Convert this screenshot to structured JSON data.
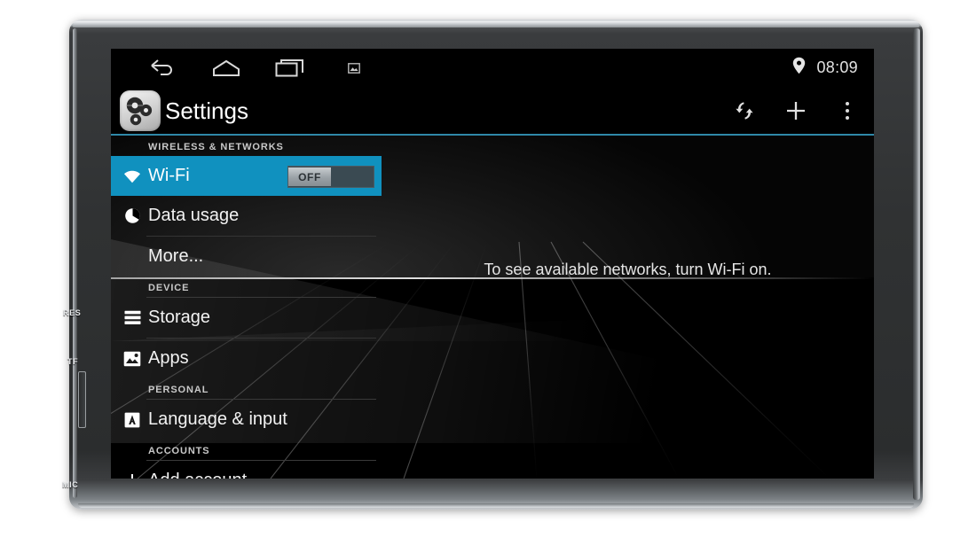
{
  "device": {
    "bezel_labels": [
      {
        "id": "res",
        "text": "RES"
      },
      {
        "id": "tf",
        "text": "TF"
      },
      {
        "id": "mic",
        "text": "MIC"
      }
    ]
  },
  "statusbar": {
    "nav_icons": [
      "back-icon",
      "home-icon",
      "recents-icon",
      "screenshot-icon"
    ],
    "location_icon": "location-pin-icon",
    "time": "08:09"
  },
  "actionbar": {
    "app_icon": "settings-gears-icon",
    "title": "Settings",
    "actions": [
      {
        "name": "sync-icon",
        "label": ""
      },
      {
        "name": "add-icon",
        "label": "+"
      },
      {
        "name": "overflow-menu-icon",
        "label": ""
      }
    ],
    "divider_color": "#2f88a8"
  },
  "settings": {
    "accent_color": "#1091bf",
    "sections": [
      {
        "header": "WIRELESS & NETWORKS",
        "items": [
          {
            "label": "Wi-Fi",
            "icon": "wifi-icon",
            "selected": true,
            "toggle": "OFF"
          },
          {
            "label": "Data usage",
            "icon": "data-usage-icon",
            "selected": false
          },
          {
            "label": "More...",
            "icon": "",
            "selected": false
          }
        ]
      },
      {
        "header": "DEVICE",
        "items": [
          {
            "label": "Storage",
            "icon": "storage-icon",
            "selected": false
          },
          {
            "label": "Apps",
            "icon": "apps-icon",
            "selected": false
          }
        ]
      },
      {
        "header": "PERSONAL",
        "items": [
          {
            "label": "Language & input",
            "icon": "language-input-icon",
            "selected": false
          }
        ]
      },
      {
        "header": "ACCOUNTS",
        "items": [
          {
            "label": "Add account",
            "icon": "plus-icon",
            "selected": false
          }
        ]
      }
    ]
  },
  "content_pane": {
    "message": "To see available networks, turn Wi-Fi on."
  }
}
